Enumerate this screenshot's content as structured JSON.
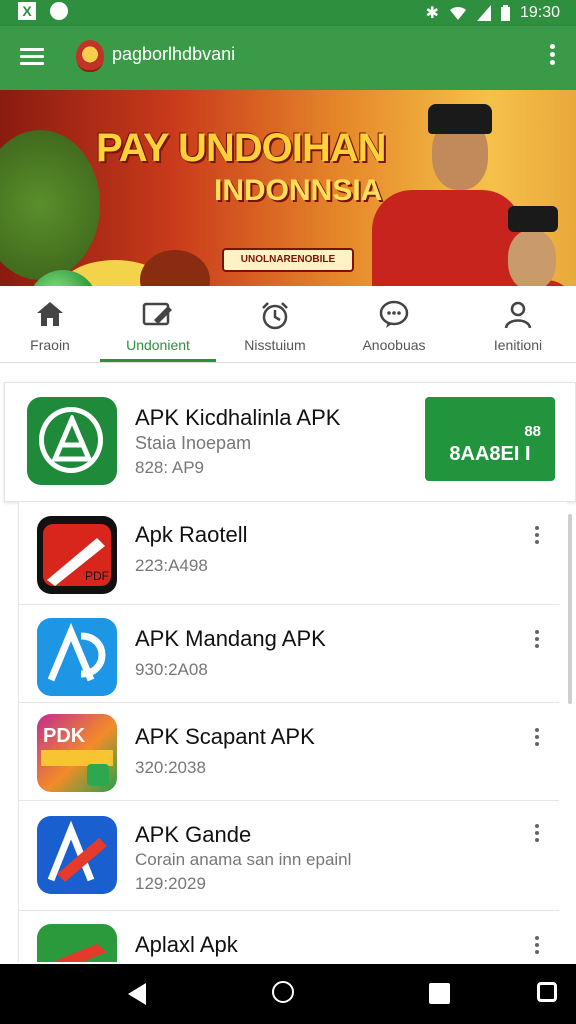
{
  "status_bar": {
    "left_icons": [
      "x-app-icon",
      "notification-icon"
    ],
    "right_icons": [
      "bluetooth-icon",
      "wifi-icon",
      "signal-icon",
      "battery-icon"
    ],
    "time": "19:30"
  },
  "app_bar": {
    "title": "pagborlhdbvani",
    "menu_icon": "menu-icon",
    "overflow_icon": "more-vert-icon"
  },
  "banner": {
    "headline": "PAY UNDOIHAN",
    "subheadline": "INDONNSIA",
    "badge": "UNOLNARENOBILE"
  },
  "tabs": [
    {
      "label": "Fraoin",
      "icon": "home-icon",
      "active": false
    },
    {
      "label": "Undonient",
      "icon": "edit-icon",
      "active": true
    },
    {
      "label": "Nisstuium",
      "icon": "timer-icon",
      "active": false
    },
    {
      "label": "Anoobuas",
      "icon": "chat-icon",
      "active": false
    },
    {
      "label": "Ienitioni",
      "icon": "person-icon",
      "active": false
    }
  ],
  "featured": {
    "title": "APK Kicdhalinla APK",
    "subtitle": "Staia Inoepam",
    "meta": "828: AP9",
    "button_top": "88",
    "button_label": "8AA8EI I"
  },
  "apps": [
    {
      "name": "Apk Raotell",
      "description": "",
      "meta": "223:A498",
      "icon": "red-app-icon",
      "icon_text": "PDF"
    },
    {
      "name": "APK Mandang APK",
      "description": "",
      "meta": "930:2A08",
      "icon": "blue-app-icon",
      "icon_text": ""
    },
    {
      "name": "APK Scapant APK",
      "description": "",
      "meta": "320:2038",
      "icon": "colorful-app-icon",
      "icon_text": "PDK"
    },
    {
      "name": "APK Gande",
      "description": "Corain anama san inn epainl",
      "meta": "129:2029",
      "icon": "blue-pencil-app-icon",
      "icon_text": ""
    },
    {
      "name": "Aplaxl Apk",
      "description": "",
      "meta": "",
      "icon": "green-red-app-icon",
      "icon_text": ""
    }
  ],
  "colors": {
    "primary": "#2e8f3e",
    "appbar": "#3a9a48",
    "button": "#23943e"
  }
}
